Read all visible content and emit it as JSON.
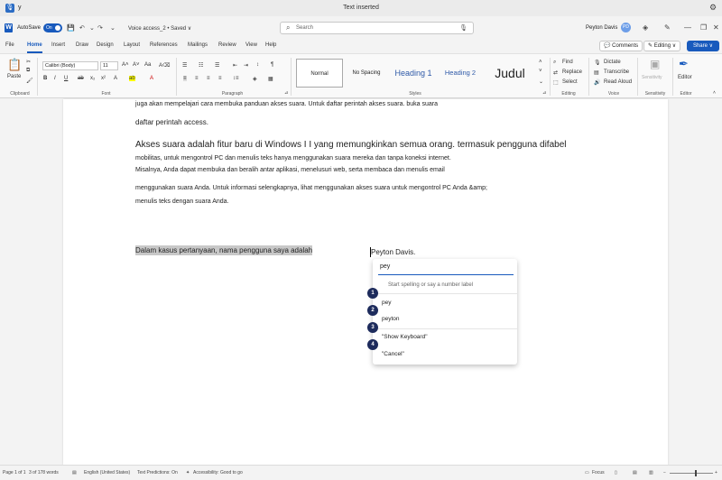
{
  "titlebar": {
    "app_letter": "y",
    "title": "Text inserted"
  },
  "qat": {
    "autosave_label": "AutoSave",
    "autosave_state": "On",
    "doc_name": "Voice access_2 • Saved ∨",
    "search_placeholder": "Search",
    "user_name": "Peyton Davis",
    "user_initials": "PD"
  },
  "tabs": [
    "File",
    "Home",
    "Insert",
    "Draw",
    "Design",
    "Layout",
    "References",
    "Mailings",
    "Review",
    "View",
    "Help"
  ],
  "header_buttons": {
    "comments": "Comments",
    "editing": "Editing ∨",
    "share": "Share ∨"
  },
  "ribbon": {
    "clipboard": {
      "paste": "Paste",
      "label": "Clipboard"
    },
    "font": {
      "family": "Calibri (Body)",
      "size": "11",
      "label": "Font"
    },
    "paragraph": {
      "label": "Paragraph"
    },
    "styles": {
      "normal": "Normal",
      "no_spacing": "No Spacing",
      "heading1": "Heading 1",
      "heading2": "Heading 2",
      "title": "Judul",
      "label": "Styles"
    },
    "editing": {
      "find": "Find",
      "replace": "Replace",
      "select": "Select",
      "label": "Editing"
    },
    "voice": {
      "dictate": "Dictate",
      "transcribe": "Transcribe",
      "read_aloud": "Read Aloud",
      "label": "Voice"
    },
    "sensitivity": {
      "btn": "Sensitivity",
      "label": "Sensitivity"
    },
    "editor": {
      "btn": "Editor",
      "label": "Editor"
    }
  },
  "document": {
    "line1": "juga akan mempelajari cara membuka panduan akses suara. Untuk daftar perintah akses suara. buka suara",
    "line2": "daftar perintah access.",
    "line3": "Akses suara adalah fitur baru di Windows I I yang memungkinkan semua orang. termasuk pengguna difabel",
    "line4": "mobilitas, untuk mengontrol PC dan menulis teks hanya menggunakan suara mereka dan tanpa koneksi internet.",
    "line5": "Misalnya, Anda dapat membuka dan beralih antar aplikasi, menelusuri web, serta membaca dan menulis email",
    "line6": "menggunakan suara Anda. Untuk informasi selengkapnya, lihat menggunakan akses suara untuk mengontrol PC Anda &amp;",
    "line7": "menulis teks dengan suara Anda.",
    "selected_line": "Dalam kasus pertanyaan, nama pengguna saya adalah",
    "name_tail": " Peyton Davis."
  },
  "popup": {
    "input_value": "pey",
    "hint": "Start spelling or say a number label",
    "items": [
      {
        "num": "1",
        "label": ""
      },
      {
        "num": "2",
        "label": "pey"
      },
      {
        "num": "3",
        "label": "peyton"
      },
      {
        "num": "4",
        "label": "\"Show Keyboard\""
      },
      {
        "num": "",
        "label": "\"Cancel\""
      }
    ]
  },
  "status": {
    "page": "Page 1 of 1",
    "words": "3 of 178 words",
    "language": "English (United States)",
    "predictions": "Text Predictions: On",
    "accessibility": "Accessibility: Good to go",
    "focus": "Focus"
  },
  "colors": {
    "accent": "#185abd",
    "badge": "#1d2b5c"
  }
}
